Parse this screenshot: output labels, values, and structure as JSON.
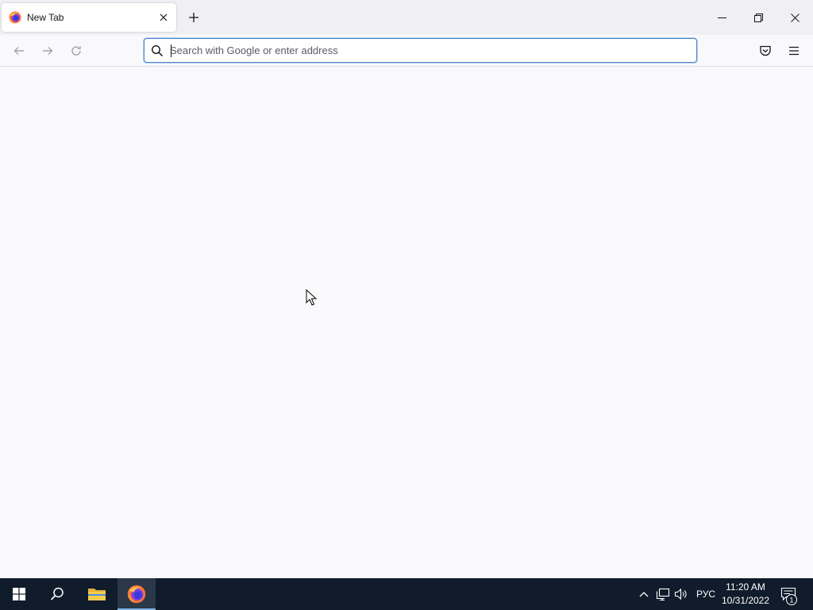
{
  "browser": {
    "tab": {
      "title": "New Tab",
      "favicon": "firefox-icon"
    },
    "new_tab_icon": "plus-icon",
    "window_controls": [
      "minimize-icon",
      "restore-icon",
      "close-icon"
    ]
  },
  "navbar": {
    "icons": [
      "back-arrow-icon",
      "forward-arrow-icon",
      "reload-icon"
    ],
    "urlbar": {
      "placeholder": "Search with Google or enter address",
      "value": ""
    },
    "right_icons": [
      "pocket-icon",
      "hamburger-menu-icon"
    ]
  },
  "taskbar": {
    "apps": [
      "windows-start-icon",
      "search-icon",
      "file-explorer-icon",
      "firefox-icon"
    ],
    "tray": {
      "language": "РУС",
      "time": "11:20 AM",
      "date": "10/31/2022",
      "notification_count": "1"
    }
  },
  "colors": {
    "tabstrip_bg": "#f0f0f4",
    "content_bg": "#f9f9fb",
    "focus_border": "#4a85c8",
    "taskbar_bg": "#101c2b"
  }
}
